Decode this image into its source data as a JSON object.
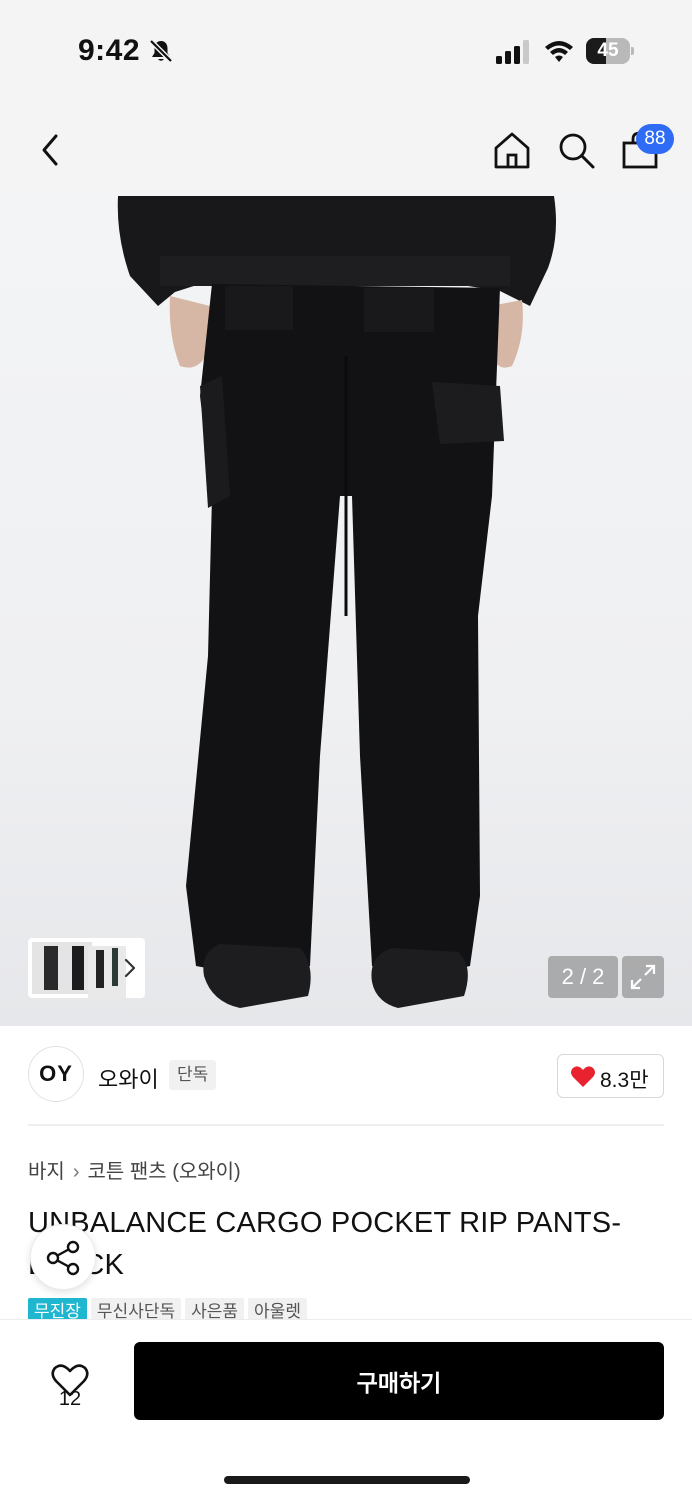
{
  "status_bar": {
    "time": "9:42",
    "battery_level": "45",
    "battery_fraction": 0.45,
    "icons": [
      "bell-slash-icon",
      "signal-icon",
      "wifi-icon",
      "battery-icon"
    ]
  },
  "nav": {
    "icons": [
      "chevron-left-icon",
      "home-icon",
      "search-icon",
      "shopping-bag-icon"
    ],
    "cart_count": "88"
  },
  "gallery": {
    "counter": "2 / 2",
    "icons": [
      "chevron-right-icon",
      "expand-icon"
    ]
  },
  "brand": {
    "logo_text": "OY",
    "name": "오와이",
    "badge": "단독",
    "likes": "8.3만"
  },
  "product": {
    "breadcrumb": [
      "바지",
      "코튼 팬츠 (오와이)"
    ],
    "title": "UNBALANCE CARGO POCKET RIP PANTS-BLACK",
    "tags": [
      "무진장",
      "무신사단독",
      "사은품",
      "아울렛"
    ]
  },
  "bottom": {
    "wishlist_count": "12",
    "buy_label": "구매하기"
  },
  "colors": {
    "accent_tag": "#1fb6cf",
    "badge_blue": "#2e6cf6",
    "heart_red": "#e8222e",
    "buy_button": "#000000"
  }
}
